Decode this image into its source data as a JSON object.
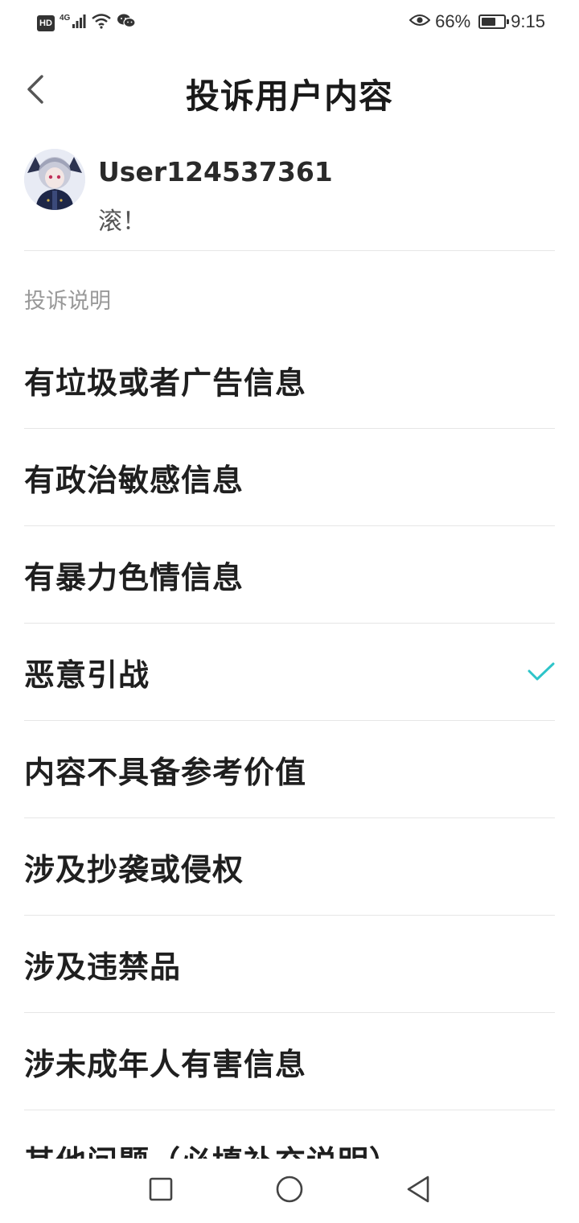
{
  "status_bar": {
    "hd_label": "HD",
    "network_label": "4G",
    "battery_text": "66%",
    "battery_level": 0.66,
    "time": "9:15"
  },
  "header": {
    "title": "投诉用户内容"
  },
  "user": {
    "name": "User124537361",
    "comment": "滚！"
  },
  "section": {
    "label": "投诉说明"
  },
  "reasons": [
    {
      "label": "有垃圾或者广告信息",
      "selected": false
    },
    {
      "label": "有政治敏感信息",
      "selected": false
    },
    {
      "label": "有暴力色情信息",
      "selected": false
    },
    {
      "label": "恶意引战",
      "selected": true
    },
    {
      "label": "内容不具备参考价值",
      "selected": false
    },
    {
      "label": "涉及抄袭或侵权",
      "selected": false
    },
    {
      "label": "涉及违禁品",
      "selected": false
    },
    {
      "label": "涉未成年人有害信息",
      "selected": false
    },
    {
      "label": "其他问题（必填补充说明）",
      "selected": false
    }
  ],
  "colors": {
    "check": "#2ec4c9",
    "text": "#1f1f1f",
    "muted": "#999999",
    "divider": "#e6e6e6"
  },
  "icons": {
    "back": "chevron-left-icon",
    "check": "check-icon",
    "nav_recent": "square-icon",
    "nav_home": "circle-icon",
    "nav_back": "triangle-left-icon"
  }
}
